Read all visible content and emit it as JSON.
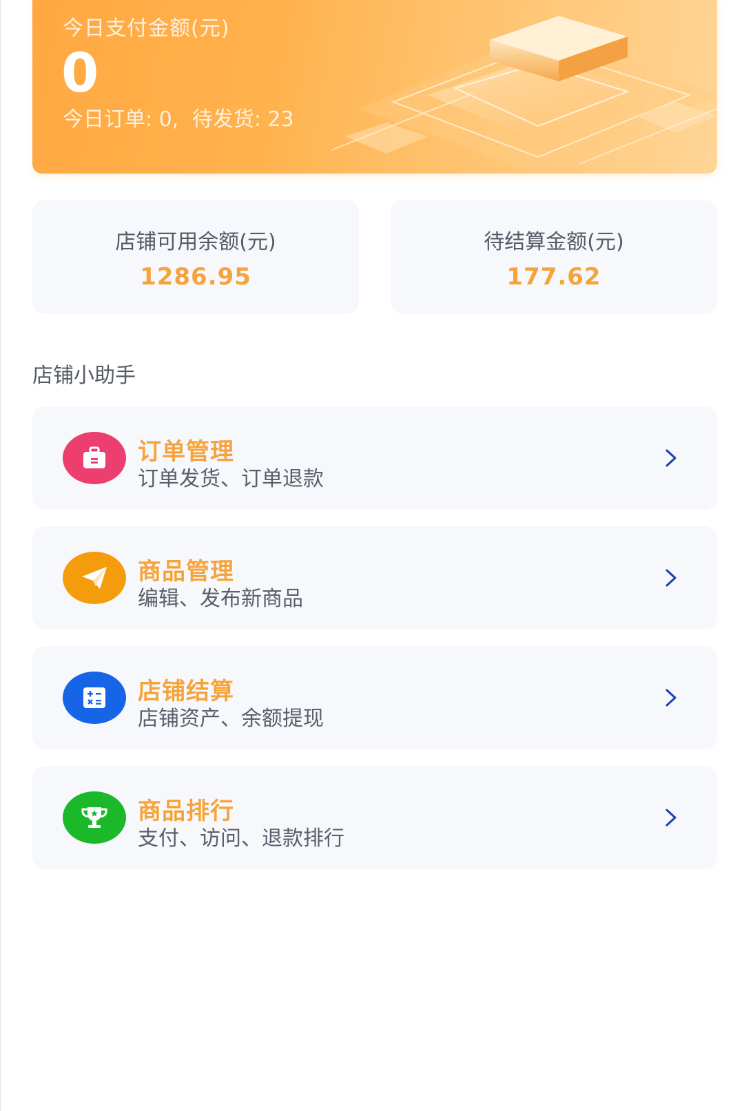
{
  "banner": {
    "label": "今日支付金额(元)",
    "amount": "0",
    "orders_text": "今日订单: 0,",
    "pending_text": "待发货: 23"
  },
  "stats": {
    "balance_label": "店铺可用余额(元)",
    "balance_value": "1286.95",
    "settle_label": "待结算金额(元)",
    "settle_value": "177.62"
  },
  "section": {
    "title": "店铺小助手"
  },
  "menu": [
    {
      "title": "订单管理",
      "subtitle": "订单发货、订单退款",
      "icon": "briefcase-icon",
      "color": "#ec3f6f"
    },
    {
      "title": "商品管理",
      "subtitle": "编辑、发布新商品",
      "icon": "paper-plane-icon",
      "color": "#f59c0c"
    },
    {
      "title": "店铺结算",
      "subtitle": "店铺资产、余额提现",
      "icon": "calculator-icon",
      "color": "#1565e6"
    },
    {
      "title": "商品排行",
      "subtitle": "支付、访问、退款排行",
      "icon": "trophy-icon",
      "color": "#1bb82a"
    }
  ],
  "colors": {
    "accent": "#f6a33c",
    "card_bg": "#f6f8fb",
    "chevron": "#1e3fae"
  }
}
